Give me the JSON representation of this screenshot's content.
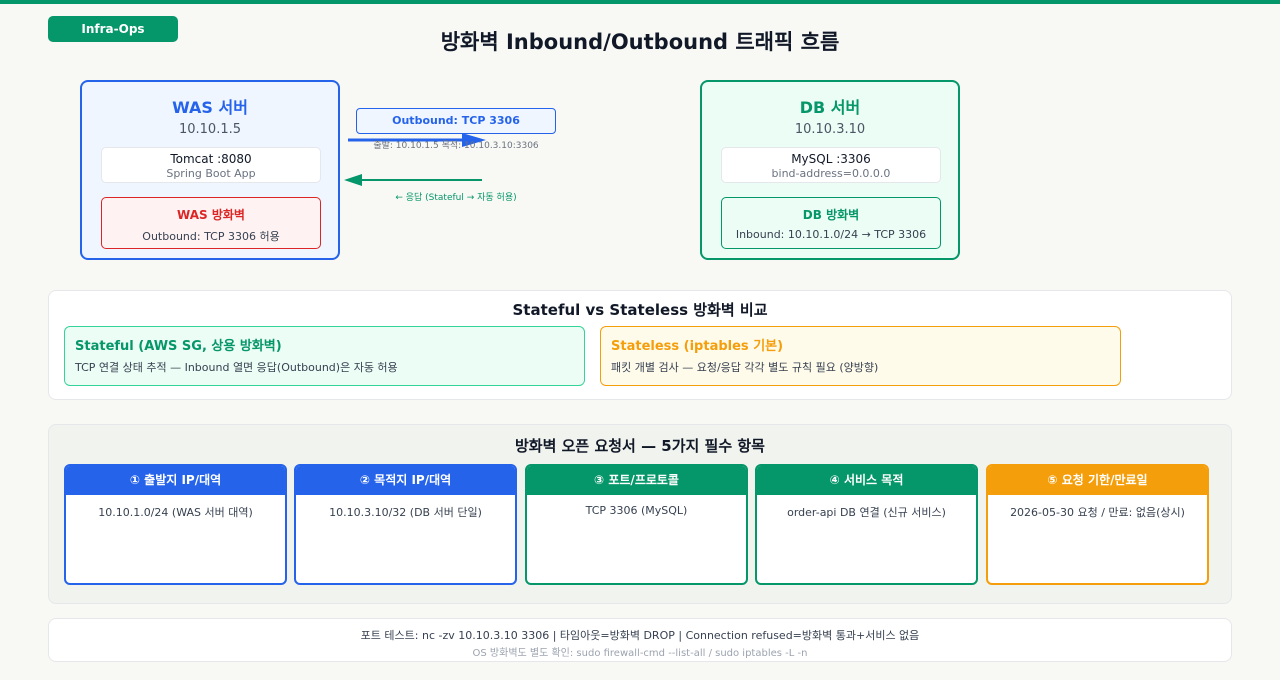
{
  "tag": "Infra-Ops",
  "title": "방화벽 Inbound/Outbound 트래픽 흐름",
  "colors": {
    "blue": "#2563eb",
    "green": "#059669",
    "red": "#dc2626",
    "amber": "#f59e0b"
  },
  "was": {
    "title": "WAS 서버",
    "ip": "10.10.1.5",
    "app_name": "Tomcat :8080",
    "app_sub": "Spring Boot App",
    "fw_title": "WAS 방화벽",
    "fw_rule": "Outbound: TCP 3306 허용"
  },
  "db": {
    "title": "DB 서버",
    "ip": "10.10.3.10",
    "app_name": "MySQL :3306",
    "app_sub": "bind-address=0.0.0.0",
    "fw_title": "DB 방화벽",
    "fw_rule": "Inbound: 10.10.1.0/24 → TCP 3306"
  },
  "flow": {
    "outbound_label": "Outbound: TCP 3306",
    "outbound_sub": "출발: 10.10.1.5 목적: 10.10.3.10:3306",
    "response_label": "← 응답 (Stateful → 자동 허용)"
  },
  "compare": {
    "title": "Stateful vs Stateless 방화벽 비교",
    "stateful": {
      "title": "Stateful (AWS SG, 상용 방화벽)",
      "desc": "TCP 연결 상태 추적 — Inbound 열면 응답(Outbound)은 자동 허용"
    },
    "stateless": {
      "title": "Stateless (iptables 기본)",
      "desc": "패킷 개별 검사 — 요청/응답 각각 별도 규칙 필요 (양방향)"
    }
  },
  "request": {
    "title": "방화벽 오픈 요청서 — 5가지 필수 항목",
    "items": [
      {
        "head": "① 출발지 IP/대역",
        "value": "10.10.1.0/24 (WAS 서버 대역)",
        "color": "#2563eb"
      },
      {
        "head": "② 목적지 IP/대역",
        "value": "10.10.3.10/32 (DB 서버 단일)",
        "color": "#2563eb"
      },
      {
        "head": "③ 포트/프로토콜",
        "value": "TCP 3306 (MySQL)",
        "color": "#059669"
      },
      {
        "head": "④ 서비스 목적",
        "value": "order-api DB 연결 (신규 서비스)",
        "color": "#059669"
      },
      {
        "head": "⑤ 요청 기한/만료일",
        "value": "2026-05-30 요청 / 만료: 없음(상시)",
        "color": "#f59e0b"
      }
    ]
  },
  "test": {
    "main": "포트 테스트: nc -zv 10.10.3.10 3306 | 타임아웃=방화벽 DROP | Connection refused=방화벽 통과+서비스 없음",
    "sub": "OS 방화벽도 별도 확인: sudo firewall-cmd --list-all / sudo iptables -L -n"
  }
}
